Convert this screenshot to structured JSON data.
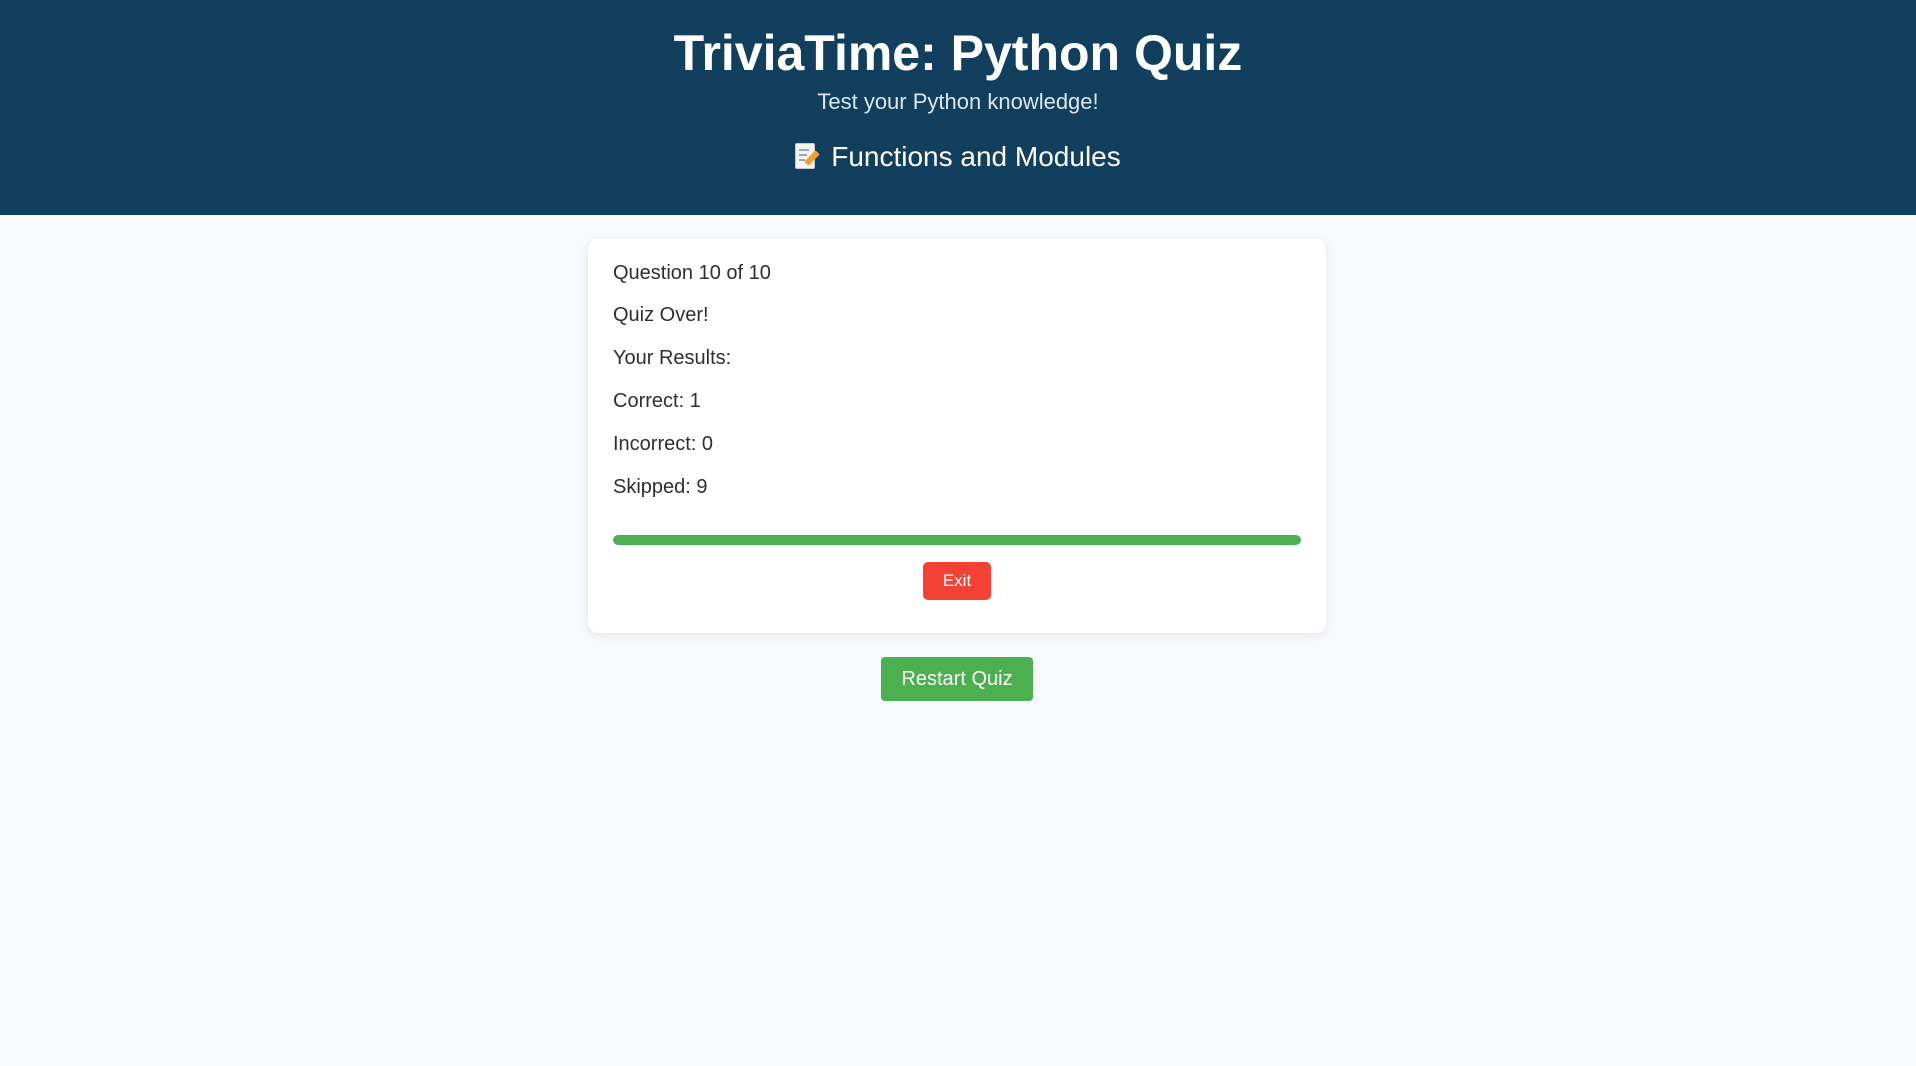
{
  "header": {
    "title": "TriviaTime: Python Quiz",
    "subtitle": "Test your Python knowledge!",
    "topic_icon": "memo-pencil-icon",
    "topic": "Functions and Modules",
    "background_color": "#123f5e"
  },
  "quiz": {
    "question_counter": "Question 10 of 10",
    "status": "Quiz Over!",
    "results_heading": "Your Results:",
    "correct": "Correct: 1",
    "incorrect": "Incorrect: 0",
    "skipped": "Skipped: 9",
    "progress_fraction": 1.0,
    "progress_color": "#4caf50"
  },
  "buttons": {
    "exit_label": "Exit",
    "exit_color": "#f44336",
    "restart_label": "Restart Quiz",
    "restart_color": "#4caf50"
  }
}
